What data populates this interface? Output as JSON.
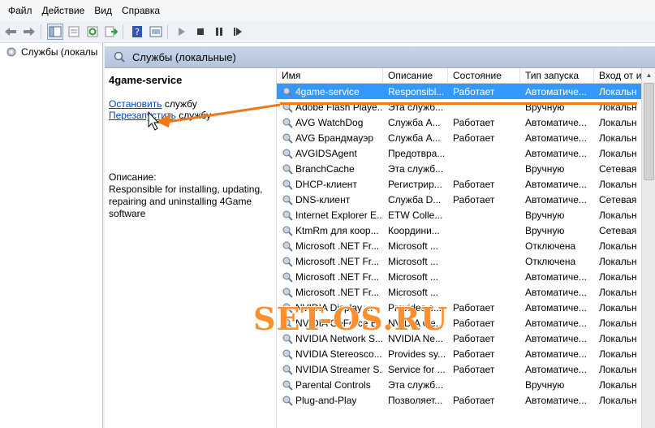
{
  "menu": [
    "Файл",
    "Действие",
    "Вид",
    "Справка"
  ],
  "tree": {
    "item": "Службы (локалы"
  },
  "pane": {
    "title": "Службы (локальные)",
    "service_name": "4game-service",
    "stop_link": "Остановить",
    "stop_rest": " службу",
    "restart_link": "Перезапустить",
    "restart_rest": " службу",
    "description_label": "Описание:",
    "description_text": "Responsible for installing, updating, repairing and uninstalling 4Game software"
  },
  "table": {
    "columns": [
      "Имя",
      "Описание",
      "Состояние",
      "Тип запуска",
      "Вход от и"
    ],
    "rows": [
      [
        "4game-service",
        "Responsibl...",
        "Работает",
        "Автоматиче...",
        "Локальн"
      ],
      [
        "Adobe Flash Playe...",
        "Эта служб...",
        "",
        "Вручную",
        "Локальн"
      ],
      [
        "AVG WatchDog",
        "Служба А...",
        "Работает",
        "Автоматиче...",
        "Локальн"
      ],
      [
        "AVG Брандмауэр",
        "Служба А...",
        "Работает",
        "Автоматиче...",
        "Локальн"
      ],
      [
        "AVGIDSAgent",
        "Предотвра...",
        "",
        "Автоматиче...",
        "Локальн"
      ],
      [
        "BranchCache",
        "Эта служб...",
        "",
        "Вручную",
        "Сетевая"
      ],
      [
        "DHCP-клиент",
        "Регистрир...",
        "Работает",
        "Автоматиче...",
        "Локальн"
      ],
      [
        "DNS-клиент",
        "Служба D...",
        "Работает",
        "Автоматиче...",
        "Сетевая"
      ],
      [
        "Internet Explorer E...",
        "ETW Colle...",
        "",
        "Вручную",
        "Локальн"
      ],
      [
        "KtmRm для коор...",
        "Координи...",
        "",
        "Вручную",
        "Сетевая"
      ],
      [
        "Microsoft .NET Fr...",
        "Microsoft ...",
        "",
        "Отключена",
        "Локальн"
      ],
      [
        "Microsoft .NET Fr...",
        "Microsoft ...",
        "",
        "Отключена",
        "Локальн"
      ],
      [
        "Microsoft .NET Fr...",
        "Microsoft ...",
        "",
        "Автоматиче...",
        "Локальн"
      ],
      [
        "Microsoft .NET Fr...",
        "Microsoft ...",
        "",
        "Автоматиче...",
        "Локальн"
      ],
      [
        "NVIDIA Display ...",
        "Provides s...",
        "Работает",
        "Автоматиче...",
        "Локальн"
      ],
      [
        "NVIDIA GeForce E...",
        "NVIDIA Ge...",
        "Работает",
        "Автоматиче...",
        "Локальн"
      ],
      [
        "NVIDIA Network S...",
        "NVIDIA Ne...",
        "Работает",
        "Автоматиче...",
        "Локальн"
      ],
      [
        "NVIDIA Stereosco...",
        "Provides sy...",
        "Работает",
        "Автоматиче...",
        "Локальн"
      ],
      [
        "NVIDIA Streamer S...",
        "Service for ...",
        "Работает",
        "Автоматиче...",
        "Локальн"
      ],
      [
        "Parental Controls",
        "Эта служб...",
        "",
        "Вручную",
        "Локальн"
      ],
      [
        "Plug-and-Play",
        "Позволяет...",
        "Работает",
        "Автоматиче...",
        "Локальн"
      ]
    ]
  },
  "watermark": "SET-OS.RU",
  "colors": {
    "selection": "#3399ff",
    "accent_orange": "#f07a1a",
    "link": "#0645ad"
  }
}
